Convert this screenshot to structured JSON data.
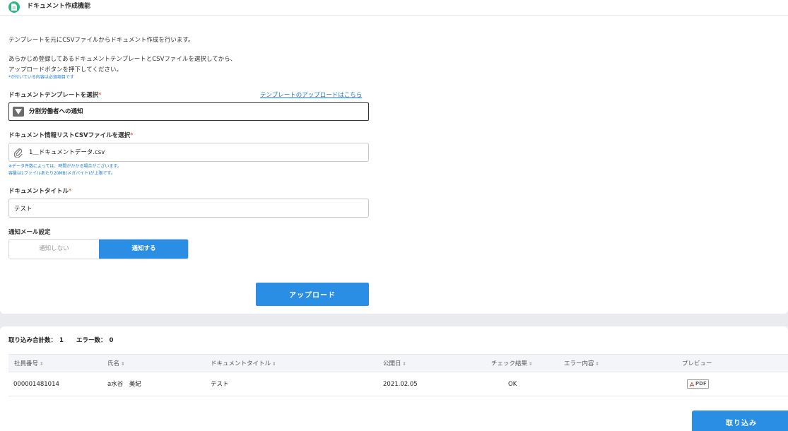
{
  "header": {
    "title": "ドキュメント作成機能",
    "icon": "document-icon"
  },
  "intro": {
    "line1": "テンプレートを元にCSVファイルからドキュメント作成を行います。",
    "line2": "あらかじめ登録してあるドキュメントテンプレートとCSVファイルを選択してから、",
    "line3": "アップロードボタンを押下してください。",
    "required_note": "*が付いている内容は必須項目です"
  },
  "template_field": {
    "label": "ドキュメントテンプレートを選択",
    "required_mark": "*",
    "link": "テンプレートのアップロードはこちら",
    "selected": "分割労働者への通知"
  },
  "csv_field": {
    "label": "ドキュメント情報リストCSVファイルを選択",
    "required_mark": "*",
    "file_name": "1＿ドキュメントデータ.csv",
    "note1": "※データ件数によっては、時間がかかる場合がございます。",
    "note2": "容量は1ファイルあたり20MB(メガバイト)が上限です。"
  },
  "title_field": {
    "label": "ドキュメントタイトル",
    "required_mark": "*",
    "value": "テスト"
  },
  "mail_setting": {
    "label": "通知メール設定",
    "options": [
      "通知しない",
      "通知する"
    ],
    "selected": "通知する"
  },
  "upload_button": "アップロード",
  "summary": {
    "total_label": "取り込み合計数：",
    "total_value": "1",
    "error_label": "エラー数：",
    "error_value": "0"
  },
  "table": {
    "columns": [
      "社員番号",
      "氏名",
      "ドキュメントタイトル",
      "公開日",
      "チェック結果",
      "エラー内容",
      "プレビュー"
    ],
    "sort_icon": "⇕",
    "rows": [
      {
        "employee_no": "000001481014",
        "name": "a水谷　美紀",
        "doc_title": "テスト",
        "publish_date": "2021.02.05",
        "check_result": "OK",
        "error": "",
        "preview": "PDF"
      }
    ]
  },
  "import_button": "取り込み",
  "colors": {
    "accent": "#2b8ee5",
    "header_icon": "#2fb67c",
    "required": "#e63c3c",
    "note": "#1a79d6"
  }
}
